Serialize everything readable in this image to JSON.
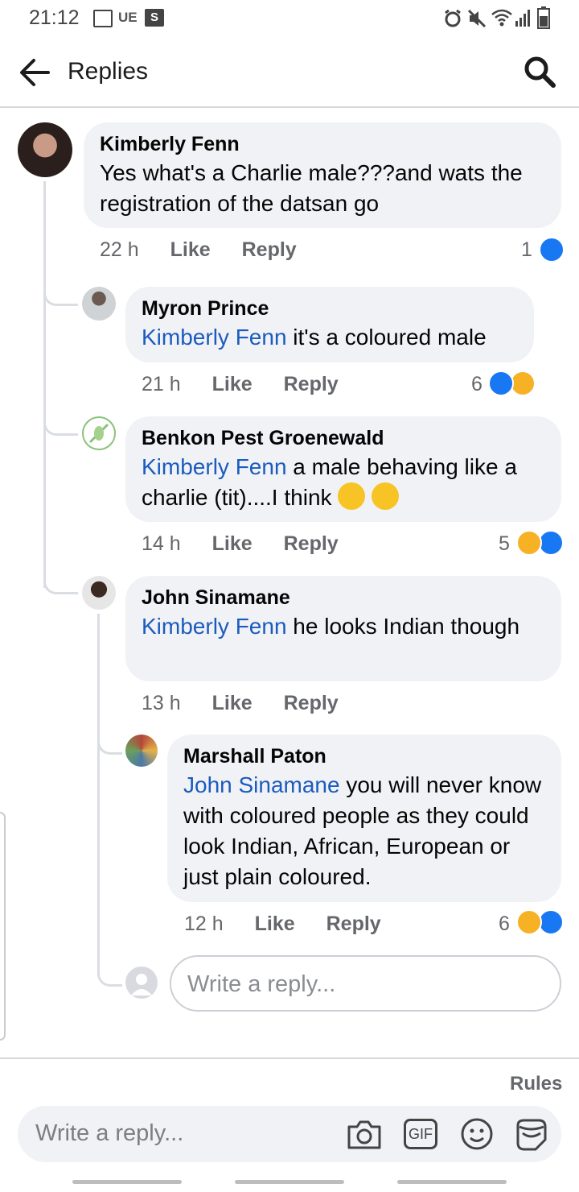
{
  "status_bar": {
    "time": "21:12",
    "carrier": "UE",
    "s_badge": "S"
  },
  "header": {
    "title": "Replies"
  },
  "comments": [
    {
      "author": "Kimberly Fenn",
      "text": "Yes what's a Charlie male???and wats the registration of the datsan go",
      "time": "22 h",
      "like": "Like",
      "reply": "Reply",
      "reactions": "1"
    },
    {
      "author": "Myron Prince",
      "mention": "Kimberly Fenn",
      "text": " it's a coloured male",
      "time": "21 h",
      "like": "Like",
      "reply": "Reply",
      "reactions": "6"
    },
    {
      "author": "Benkon Pest Groenewald",
      "mention": "Kimberly Fenn",
      "text": " a male behaving like a charlie (tit)....I think ",
      "time": "14 h",
      "like": "Like",
      "reply": "Reply",
      "reactions": "5"
    },
    {
      "author": "John Sinamane",
      "mention": "Kimberly Fenn",
      "text": " he looks Indian though",
      "time": "13 h",
      "like": "Like",
      "reply": "Reply"
    },
    {
      "author": "Marshall Paton",
      "mention": "John Sinamane",
      "text": " you will never know with coloured people as they could look Indian, African, European or just plain coloured.",
      "time": "12 h",
      "like": "Like",
      "reply": "Reply",
      "reactions": "6"
    }
  ],
  "inline_reply": {
    "placeholder": "Write a reply..."
  },
  "footer": {
    "rules": "Rules",
    "placeholder": "Write a reply...",
    "gif_label": "GIF"
  },
  "colors": {
    "like_blue": "#1877f2",
    "mention_blue": "#1b5bbf",
    "bubble_gray": "#f0f2f5"
  }
}
